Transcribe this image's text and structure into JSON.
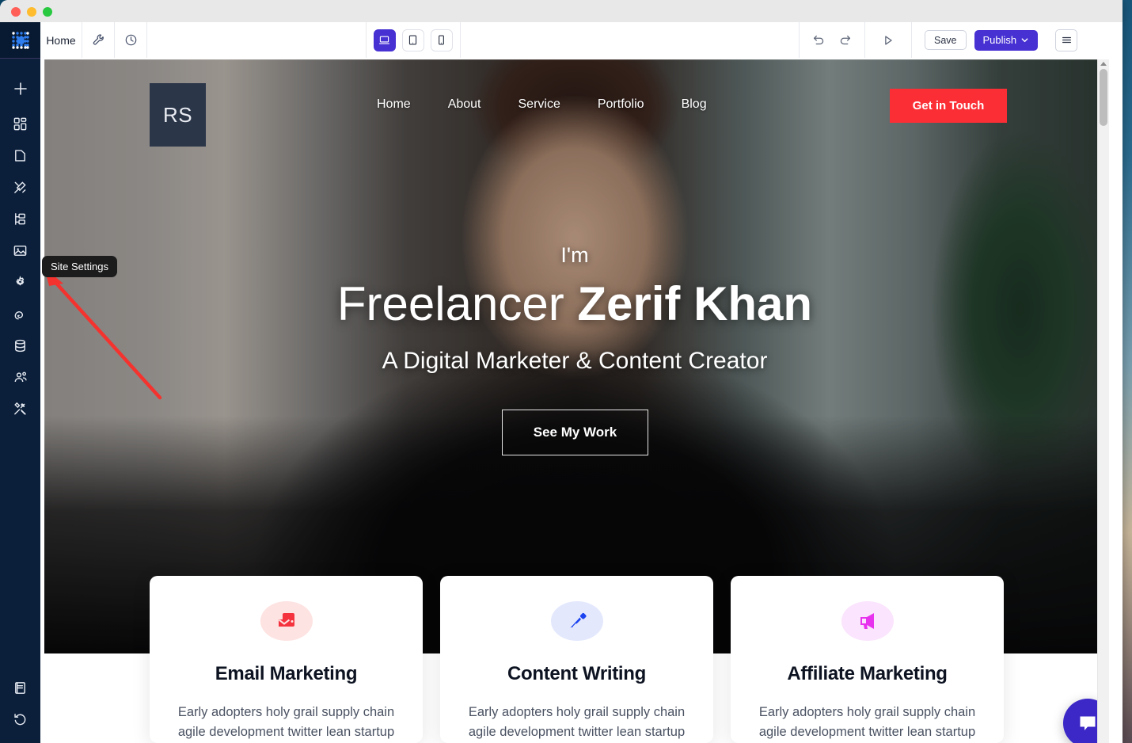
{
  "window": {
    "traffic_lights": [
      "close",
      "minimize",
      "zoom"
    ]
  },
  "rail": {
    "logo_icon": "dot-grid-logo-icon",
    "items": [
      {
        "icon": "plus-icon",
        "name": "add"
      },
      {
        "icon": "widgets-icon",
        "name": "widgets"
      },
      {
        "icon": "page-icon",
        "name": "pages"
      },
      {
        "icon": "design-icon",
        "name": "design"
      },
      {
        "icon": "sitemap-icon",
        "name": "structure"
      },
      {
        "icon": "image-icon",
        "name": "media"
      },
      {
        "icon": "gear-icon",
        "name": "site-settings"
      },
      {
        "icon": "broadcast-icon",
        "name": "marketing"
      },
      {
        "icon": "database-icon",
        "name": "database"
      },
      {
        "icon": "people-icon",
        "name": "people"
      },
      {
        "icon": "tools-icon",
        "name": "apps"
      }
    ],
    "bottom_items": [
      {
        "icon": "book-icon",
        "name": "docs"
      },
      {
        "icon": "history-icon",
        "name": "history"
      }
    ]
  },
  "topbar": {
    "page_label": "Home",
    "wrench_icon": "wrench-icon",
    "clock_icon": "clock-icon",
    "devices": [
      {
        "name": "desktop",
        "icon": "desktop-icon",
        "active": true
      },
      {
        "name": "tablet",
        "icon": "tablet-icon",
        "active": false
      },
      {
        "name": "mobile",
        "icon": "mobile-icon",
        "active": false
      }
    ],
    "undo_icon": "undo-icon",
    "redo_icon": "redo-icon",
    "preview_icon": "play-preview-icon",
    "save_label": "Save",
    "publish_label": "Publish",
    "publish_caret": "chevron-down-icon",
    "menu_icon": "hamburger-menu-icon",
    "accent_color": "#4731d3"
  },
  "tooltip": {
    "label": "Site Settings"
  },
  "annotation": {
    "arrow_color": "#f4332f"
  },
  "site": {
    "logo_text": "RS",
    "nav_links": [
      "Home",
      "About",
      "Service",
      "Portfolio",
      "Blog"
    ],
    "cta_label": "Get in Touch",
    "cta_color": "#fb2e36",
    "hero": {
      "intro": "I'm",
      "title_light": "Freelancer",
      "title_bold": "Zerif Khan",
      "subtitle": "A Digital Marketer & Content Creator",
      "button_label": "See My Work"
    },
    "cards": [
      {
        "icon": "email-marketing-icon",
        "icon_color": "#f5333f",
        "icon_bg": "#fde3e2",
        "title": "Email Marketing",
        "text": "Early adopters holy grail supply chain agile development twitter lean startup"
      },
      {
        "icon": "pen-nib-icon",
        "icon_color": "#1b43ef",
        "icon_bg": "#e3e8fd",
        "title": "Content Writing",
        "text": "Early adopters holy grail supply chain agile development twitter lean startup"
      },
      {
        "icon": "megaphone-icon",
        "icon_color": "#e833ee",
        "icon_bg": "#fbe4fd",
        "title": "Affiliate Marketing",
        "text": "Early adopters holy grail supply chain agile development twitter lean startup"
      }
    ],
    "chat_widget_icon": "chat-bubble-icon"
  },
  "scrollbar": {
    "up_arrow_icon": "scroll-up-arrow-icon"
  }
}
